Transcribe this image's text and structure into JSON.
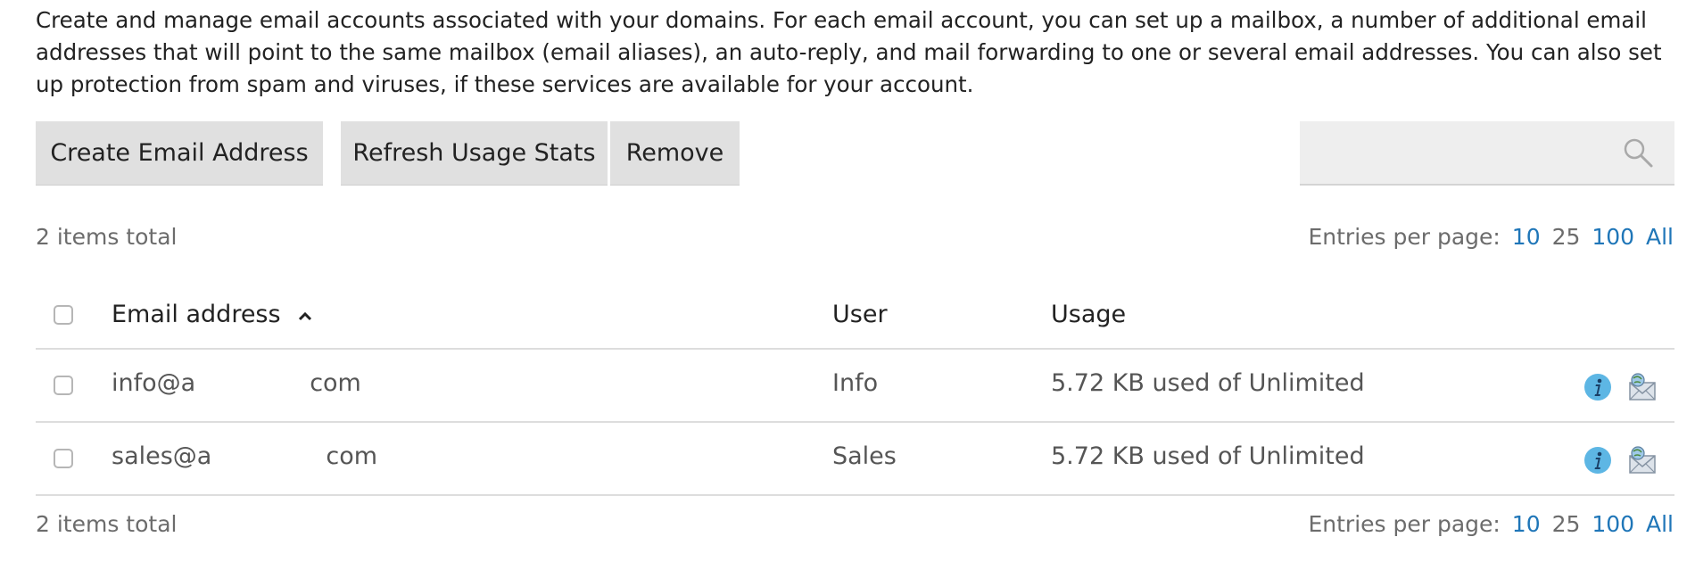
{
  "intro": {
    "text": "Create and manage email accounts associated with your domains. For each email account, you can set up a mailbox, a number of additional email addresses that will point to the same mailbox (email aliases), an auto-reply, and mail forwarding to one or several email addresses. You can also set up protection from spam and viruses, if these services are available for your account."
  },
  "toolbar": {
    "create_label": "Create Email Address",
    "refresh_label": "Refresh Usage Stats",
    "remove_label": "Remove"
  },
  "search": {
    "value": "",
    "placeholder": "",
    "icon": "search-icon"
  },
  "summary": {
    "top_count": "2 items total",
    "bottom_count": "2 items total",
    "entries_label": "Entries per page:",
    "entries_options": [
      "10",
      "25",
      "100",
      "All"
    ],
    "entries_selected": "25"
  },
  "table": {
    "columns": {
      "email": "Email address",
      "user": "User",
      "usage": "Usage"
    },
    "sort": {
      "column": "email",
      "direction": "ascending",
      "icon": "chevron-up-icon"
    },
    "rows": [
      {
        "email_start": "info@a",
        "email_end": "com",
        "user": "Info",
        "usage": "5.72 KB used of Unlimited"
      },
      {
        "email_start": "sales@a",
        "email_end": "com",
        "user": "Sales",
        "usage": "5.72 KB used of Unlimited"
      }
    ],
    "row_icons": [
      "info-icon",
      "mail-forward-icon"
    ]
  },
  "colors": {
    "link": "#1f76b8",
    "button_bg": "#e0e0e0",
    "muted_text": "#6c6c6c",
    "info_icon": "#5db6e4"
  }
}
